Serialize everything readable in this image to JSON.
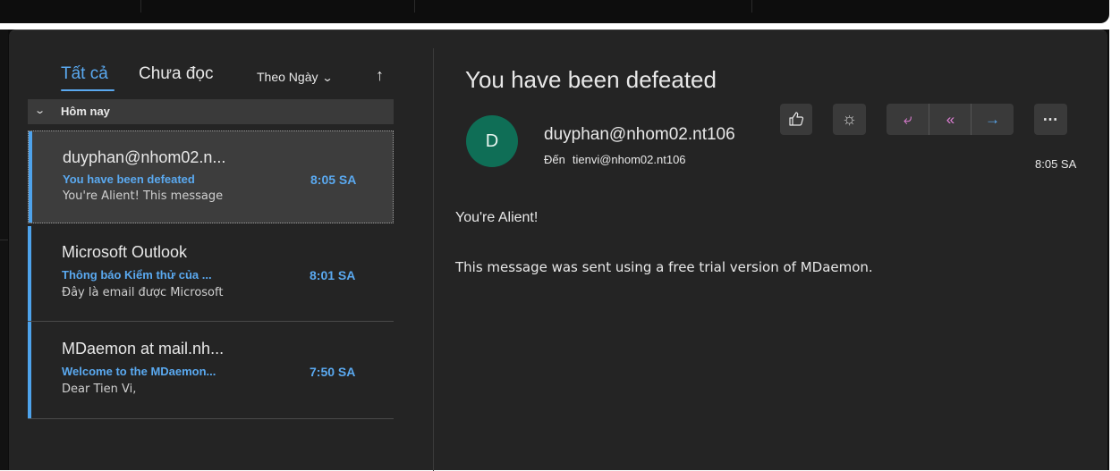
{
  "list": {
    "tabs": [
      {
        "label": "Tất cả"
      },
      {
        "label": "Chưa đọc"
      }
    ],
    "sort_label": "Theo Ngày",
    "sort_direction_icon": "↑",
    "group": {
      "label": "Hôm nay"
    },
    "items": [
      {
        "sender": "duyphan@nhom02.n...",
        "subject": "You have been defeated",
        "time": "8:05 SA",
        "preview": "You're Alient!  This message"
      },
      {
        "sender": "Microsoft Outlook",
        "subject": "Thông báo Kiểm thử của ...",
        "time": "8:01 SA",
        "preview": "Đây là email được Microsoft"
      },
      {
        "sender": "MDaemon at mail.nh...",
        "subject": "Welcome to the MDaemon...",
        "time": "7:50 SA",
        "preview": "Dear Tien Vi,"
      }
    ]
  },
  "reading": {
    "title": "You have been defeated",
    "avatar_initial": "D",
    "from": "duyphan@nhom02.nt106",
    "to_label": "Đến",
    "to": "tienvi@nhom02.nt106",
    "time": "8:05 SA",
    "body_line1": "You're Alient!",
    "body_line2": "This message was sent using a free trial version of MDaemon."
  },
  "icons": {
    "like": "thumbs-up-icon",
    "sun": "sun-icon",
    "reply": "reply-icon",
    "reply_all": "reply-all-icon",
    "forward": "forward-icon",
    "more": "more-icon"
  },
  "colors": {
    "accent": "#5aa9f0",
    "avatar_bg": "#0f6e56",
    "reply_icon": "#e07fd6"
  }
}
